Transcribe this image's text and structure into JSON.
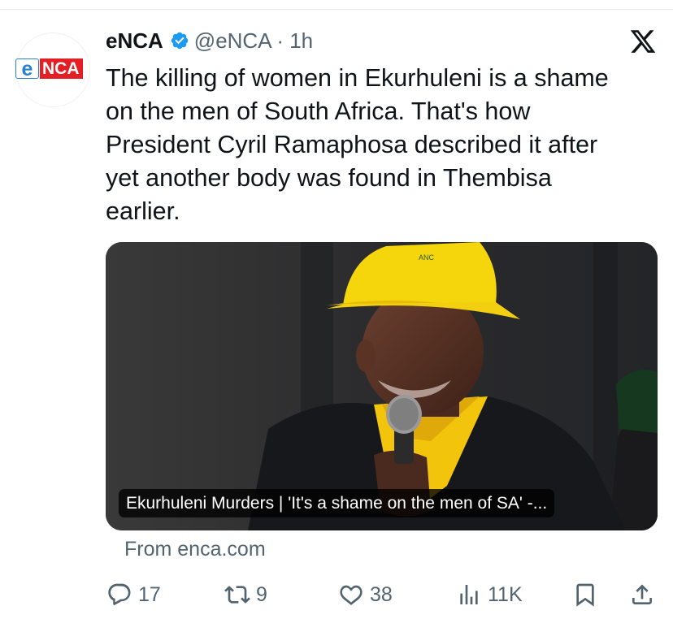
{
  "tweet": {
    "author_name": "eNCA",
    "handle_time": "@eNCA · 1h",
    "avatar_logo": {
      "left": "e",
      "right": "NCA"
    },
    "text": "The killing of women in Ekurhuleni is a shame\non the men of South Africa. That's how\nPresident Cyril Ramaphosa described it after\nyet another body was found in Thembisa\nearlier.",
    "card": {
      "caption": "Ekurhuleni Murders | 'It's a shame on the men of SA' -...",
      "hat_text": "ANC",
      "source": "From enca.com"
    }
  },
  "actions": {
    "replies": "17",
    "retweets": "9",
    "likes": "38",
    "views": "11K"
  },
  "colors": {
    "verified": "#1d9bf0",
    "secondary_text": "#536471",
    "logo_red": "#e31e24",
    "logo_blue": "#2a7fd2"
  },
  "icons": [
    "verified-badge-icon",
    "x-logo-icon",
    "reply-icon",
    "retweet-icon",
    "like-icon",
    "views-icon",
    "bookmark-icon",
    "share-icon"
  ]
}
